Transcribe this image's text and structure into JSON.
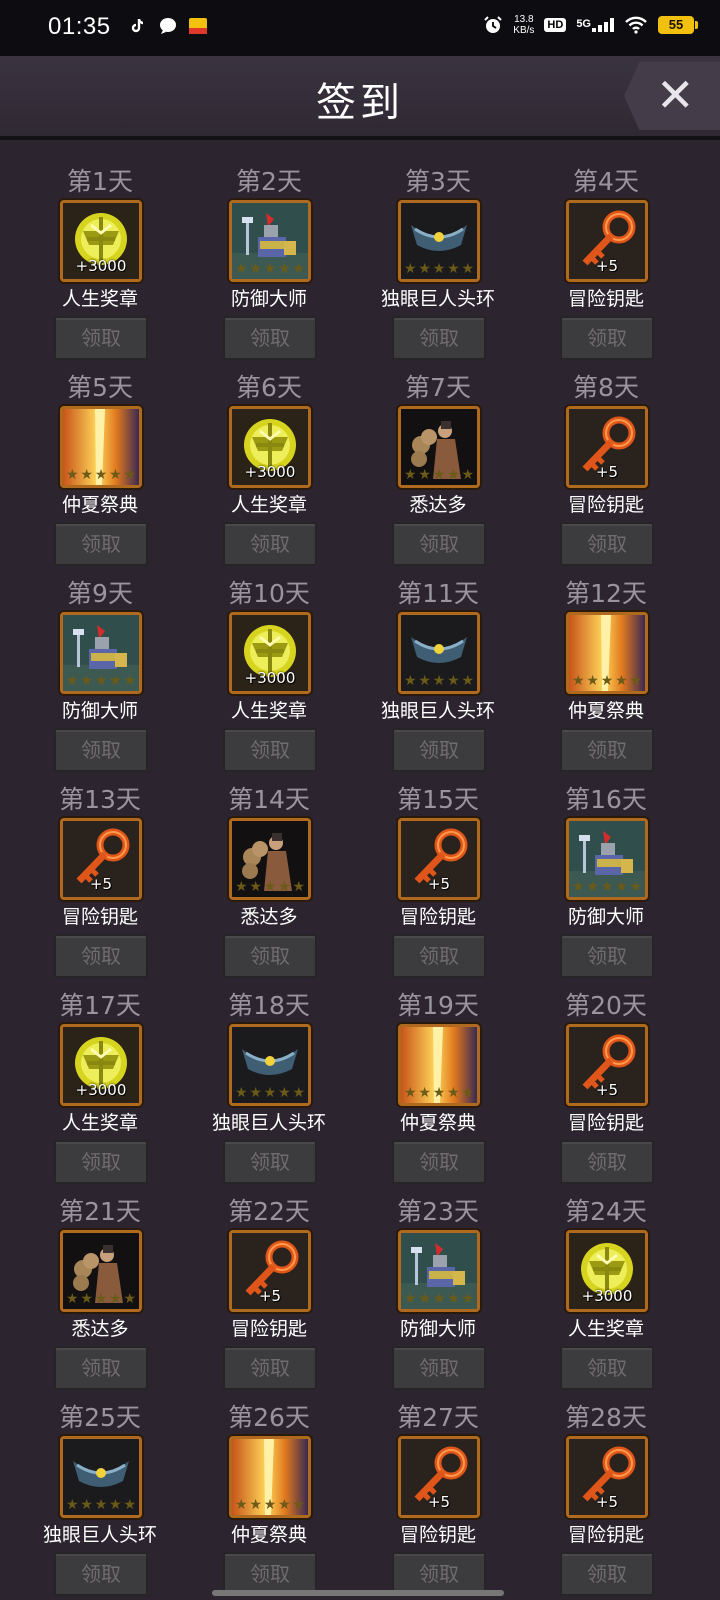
{
  "status_bar": {
    "time": "01:35",
    "net_speed_value": "13.8",
    "net_speed_unit": "KB/s",
    "hd_label": "HD",
    "network": "5G",
    "battery": "55"
  },
  "header": {
    "title": "签到",
    "close_glyph": "✕"
  },
  "claim_label": "领取",
  "days": [
    {
      "day": "第1天",
      "name": "人生奖章",
      "icon": "medal-icon",
      "qty": "+3000"
    },
    {
      "day": "第2天",
      "name": "防御大师",
      "icon": "knight-icon",
      "qty": ""
    },
    {
      "day": "第3天",
      "name": "独眼巨人头环",
      "icon": "circlet-icon",
      "qty": ""
    },
    {
      "day": "第4天",
      "name": "冒险钥匙",
      "icon": "key-icon",
      "qty": "+5"
    },
    {
      "day": "第5天",
      "name": "仲夏祭典",
      "icon": "flame-icon",
      "qty": ""
    },
    {
      "day": "第6天",
      "name": "人生奖章",
      "icon": "medal-icon",
      "qty": "+3000"
    },
    {
      "day": "第7天",
      "name": "悉达多",
      "icon": "sage-icon",
      "qty": ""
    },
    {
      "day": "第8天",
      "name": "冒险钥匙",
      "icon": "key-icon",
      "qty": "+5"
    },
    {
      "day": "第9天",
      "name": "防御大师",
      "icon": "knight-icon",
      "qty": ""
    },
    {
      "day": "第10天",
      "name": "人生奖章",
      "icon": "medal-icon",
      "qty": "+3000"
    },
    {
      "day": "第11天",
      "name": "独眼巨人头环",
      "icon": "circlet-icon",
      "qty": ""
    },
    {
      "day": "第12天",
      "name": "仲夏祭典",
      "icon": "flame-icon",
      "qty": ""
    },
    {
      "day": "第13天",
      "name": "冒险钥匙",
      "icon": "key-icon",
      "qty": "+5"
    },
    {
      "day": "第14天",
      "name": "悉达多",
      "icon": "sage-icon",
      "qty": ""
    },
    {
      "day": "第15天",
      "name": "冒险钥匙",
      "icon": "key-icon",
      "qty": "+5"
    },
    {
      "day": "第16天",
      "name": "防御大师",
      "icon": "knight-icon",
      "qty": ""
    },
    {
      "day": "第17天",
      "name": "人生奖章",
      "icon": "medal-icon",
      "qty": "+3000"
    },
    {
      "day": "第18天",
      "name": "独眼巨人头环",
      "icon": "circlet-icon",
      "qty": ""
    },
    {
      "day": "第19天",
      "name": "仲夏祭典",
      "icon": "flame-icon",
      "qty": ""
    },
    {
      "day": "第20天",
      "name": "冒险钥匙",
      "icon": "key-icon",
      "qty": "+5"
    },
    {
      "day": "第21天",
      "name": "悉达多",
      "icon": "sage-icon",
      "qty": ""
    },
    {
      "day": "第22天",
      "name": "冒险钥匙",
      "icon": "key-icon",
      "qty": "+5"
    },
    {
      "day": "第23天",
      "name": "防御大师",
      "icon": "knight-icon",
      "qty": ""
    },
    {
      "day": "第24天",
      "name": "人生奖章",
      "icon": "medal-icon",
      "qty": "+3000"
    },
    {
      "day": "第25天",
      "name": "独眼巨人头环",
      "icon": "circlet-icon",
      "qty": ""
    },
    {
      "day": "第26天",
      "name": "仲夏祭典",
      "icon": "flame-icon",
      "qty": ""
    },
    {
      "day": "第27天",
      "name": "冒险钥匙",
      "icon": "key-icon",
      "qty": "+5"
    },
    {
      "day": "第28天",
      "name": "冒险钥匙",
      "icon": "key-icon",
      "qty": "+5"
    }
  ],
  "colors": {
    "background": "#2c2530",
    "frame": "#b06a1f",
    "medal": "#d6d41e",
    "key": "#e0561a"
  }
}
